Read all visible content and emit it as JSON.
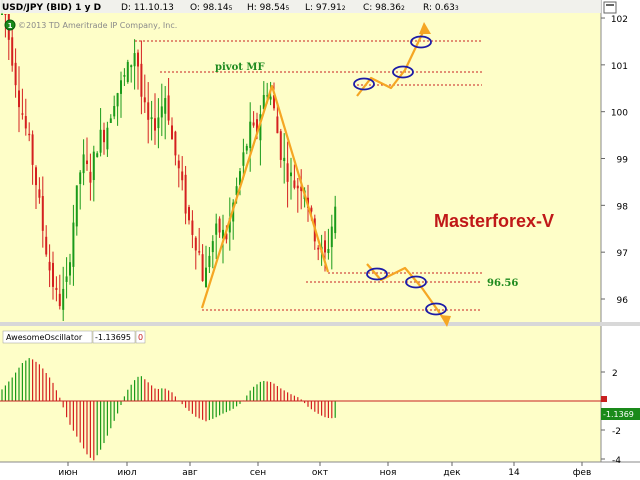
{
  "header": {
    "symbol": "USD/JPY (BID) 1 y D",
    "date": "D: 11.10.13",
    "open": "O: 98.14",
    "open_sub": "5",
    "high": "H: 98.54",
    "high_sub": "5",
    "low": "L: 97.91",
    "low_sub": "2",
    "close": "C: 98.36",
    "close_sub": "2",
    "range": "R: 0.63",
    "range_sub": "3",
    "copyright": "©2013 TD Ameritrade IP Company, Inc."
  },
  "annotations": {
    "brand": "Masterforex-V",
    "pivot_label": "pivot MF",
    "price_label": "96.56"
  },
  "oscillator": {
    "name": "AwesomeOscillator",
    "value_label": "-1.13695",
    "zero_label": "0",
    "current_badge": "-1.1369"
  },
  "colors": {
    "background": "#fefec8",
    "up_candle": "#1a9a1a",
    "down_candle": "#d42020",
    "pattern": "#f5a623",
    "marker": "#1c1ca8",
    "level": "#c82020",
    "brand": "#c01818",
    "pivot_text": "#1e8a1e",
    "header_bg": "#f0f0f0",
    "badge": "#1a8a1a"
  },
  "chart_data": [
    {
      "type": "candlestick",
      "title": "USD/JPY (BID) 1 y D",
      "price_axis": {
        "ticks": [
          96,
          97,
          98,
          99,
          100,
          101,
          102
        ],
        "ylim": [
          95.4,
          102.4
        ],
        "side": "right"
      },
      "time_axis": {
        "ticks": [
          "июн",
          "июл",
          "авг",
          "сен",
          "окт",
          "ноя",
          "дек",
          "14",
          "фев"
        ]
      },
      "levels": [
        101.52,
        100.87,
        100.58,
        96.56,
        96.5,
        95.82
      ],
      "pattern_path": [
        [
          95.82
        ],
        [
          100.58
        ],
        [
          96.56
        ]
      ]
    },
    {
      "type": "bar",
      "title": "AwesomeOscillator",
      "ylim": [
        -4.5,
        3.5
      ],
      "y_ticks": [
        2,
        0,
        -2,
        -4
      ],
      "current_value": -1.13695
    }
  ]
}
